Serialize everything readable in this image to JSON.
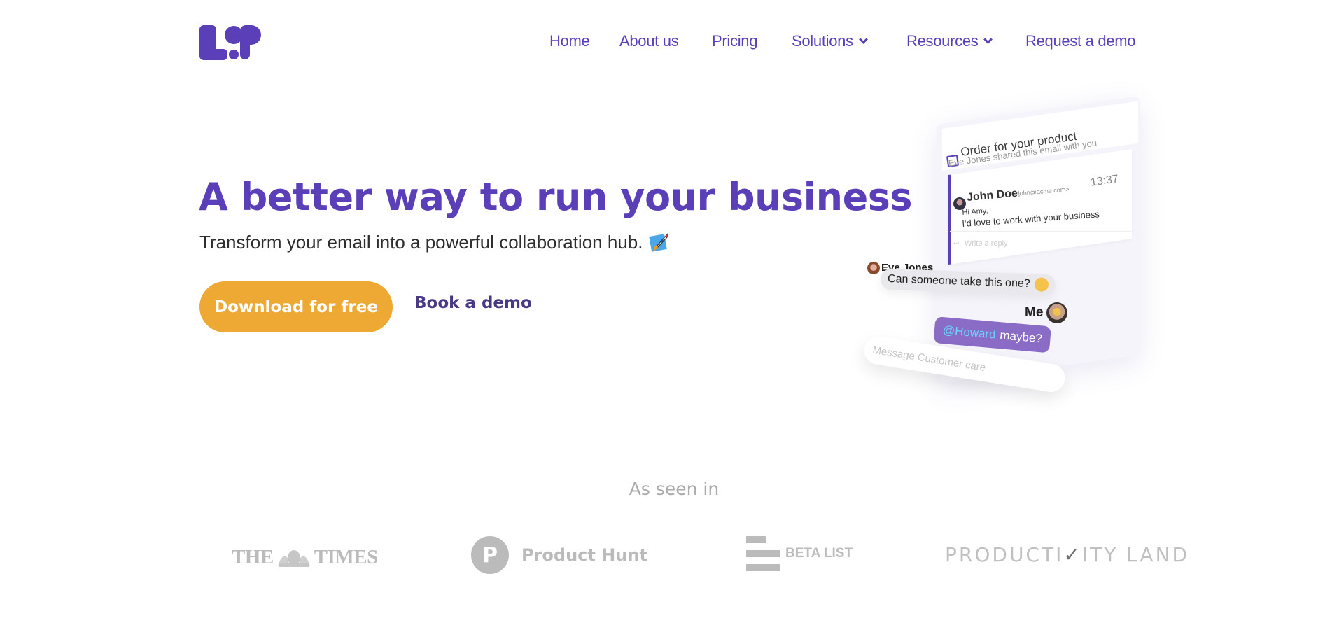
{
  "brand": {
    "logo_text": "L:P",
    "accent": "#5a3fb8",
    "cta_color": "#eea834"
  },
  "nav": {
    "items": [
      {
        "label": "Home",
        "has_dropdown": false
      },
      {
        "label": "About us",
        "has_dropdown": false
      },
      {
        "label": "Pricing",
        "has_dropdown": false
      },
      {
        "label": "Solutions",
        "has_dropdown": true
      },
      {
        "label": "Resources",
        "has_dropdown": true
      },
      {
        "label": "Request a demo",
        "has_dropdown": false
      }
    ]
  },
  "hero": {
    "title": "A better way to run your business",
    "subtitle": "Transform your email into a powerful collaboration hub.",
    "subtitle_icon": "rocket-icon",
    "primary_cta": "Download for free",
    "secondary_cta": "Book a demo"
  },
  "illustration": {
    "email_subject": "Order for your product",
    "shared_note": "Eve Jones shared this email with you",
    "email_time": "13:37",
    "sender_name": "John Doe",
    "sender_email": "<john@acme.com>",
    "body_line1": "Hi Amy,",
    "body_line2": "I'd love to work with your business",
    "reply_placeholder": "Write a reply",
    "chat": [
      {
        "author": "Eve Jones",
        "text": "Can someone take this one?",
        "emoji": "relieved-face"
      },
      {
        "author": "Me",
        "mention": "@Howard",
        "text": "maybe?"
      }
    ],
    "message_placeholder": "Message Customer care"
  },
  "press": {
    "label": "As seen in",
    "logos": [
      {
        "name": "THE TIMES",
        "left": "THE",
        "right": "TIMES"
      },
      {
        "name": "Product Hunt",
        "mark": "P"
      },
      {
        "name": "BETA LIST"
      },
      {
        "name": "PRODUCTIVITY LAND",
        "left": "PRODUCTI",
        "mark": "✓",
        "right": "ITY LAND"
      }
    ]
  }
}
